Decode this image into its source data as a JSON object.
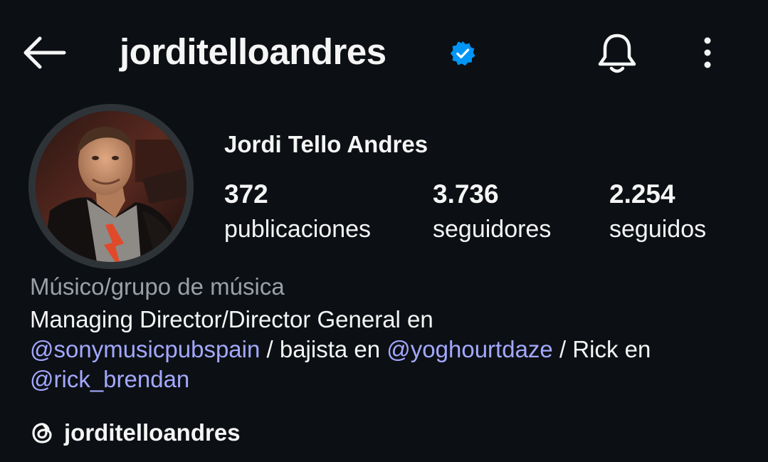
{
  "header": {
    "username": "jorditelloandres",
    "back_icon": "arrow-left-icon",
    "verified_icon": "verified-badge-icon",
    "bell_icon": "bell-icon",
    "more_icon": "more-vertical-icon"
  },
  "profile": {
    "full_name": "Jordi Tello Andres",
    "stats": {
      "posts": {
        "value": "372",
        "label": "publicaciones"
      },
      "followers": {
        "value": "3.736",
        "label": "seguidores"
      },
      "following": {
        "value": "2.254",
        "label": "seguidos"
      }
    },
    "category": "Músico/grupo de música",
    "bio": {
      "line1": "Managing Director/Director General en",
      "mention1": "sonymusicpubspain",
      "text2": " / bajista en ",
      "mention2": "yoghourtdaze",
      "text3": " / Rick en",
      "mention3": "rick_brendan"
    },
    "threads": {
      "icon": "threads-icon",
      "username": "jorditelloandres"
    }
  },
  "colors": {
    "background": "#0c1014",
    "text": "#f5f5f5",
    "muted": "#9aa0a6",
    "mention": "#a3a8ff",
    "verified": "#0095f6"
  }
}
